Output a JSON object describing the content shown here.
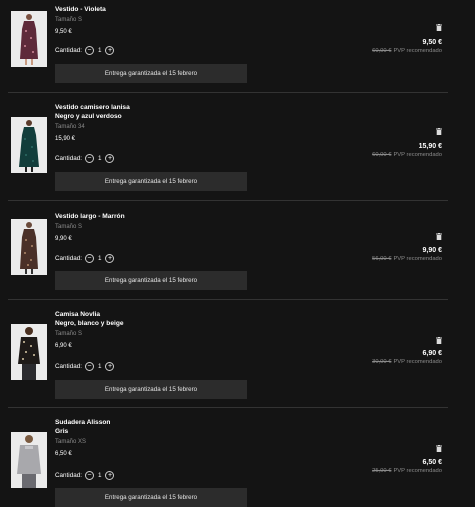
{
  "cart": {
    "quantity_label": "Cantidad:",
    "items": [
      {
        "name_line1": "Vestido - Violeta",
        "name_line2": "",
        "size": "Tamaño S",
        "unit_price": "9,50 €",
        "quantity": "1",
        "delivery": "Entrega garantizada el 15 febrero",
        "price": "9,50 €",
        "old_price": "60,00 €",
        "rrp_label": "PVP recomendado",
        "colors": {
          "garment": "#5e2a3a",
          "pattern": "#d08a9a"
        }
      },
      {
        "name_line1": "Vestido camisero Ianisa",
        "name_line2": "Negro y azul verdoso",
        "size": "Tamaño 34",
        "unit_price": "15,90 €",
        "quantity": "1",
        "delivery": "Entrega garantizada el 15 febrero",
        "price": "15,90 €",
        "old_price": "60,00 €",
        "rrp_label": "PVP recomendado",
        "colors": {
          "garment": "#123d3b",
          "pattern": "#2c6b63"
        }
      },
      {
        "name_line1": "Vestido largo - Marrón",
        "name_line2": "",
        "size": "Tamaño S",
        "unit_price": "9,90 €",
        "quantity": "1",
        "delivery": "Entrega garantizada el 15 febrero",
        "price": "9,90 €",
        "old_price": "56,00 €",
        "rrp_label": "PVP recomendado",
        "colors": {
          "garment": "#4a3028",
          "pattern": "#b08a6a"
        }
      },
      {
        "name_line1": "Camisa Novlia",
        "name_line2": "Negro, blanco y beige",
        "size": "Tamaño S",
        "unit_price": "6,90 €",
        "quantity": "1",
        "delivery": "Entrega garantizada el 15 febrero",
        "price": "6,90 €",
        "old_price": "30,00 €",
        "rrp_label": "PVP recomendado",
        "colors": {
          "garment": "#1e1a18",
          "pattern": "#d9c9a8"
        }
      },
      {
        "name_line1": "Sudadera Alisson",
        "name_line2": "Gris",
        "size": "Tamaño XS",
        "unit_price": "6,50 €",
        "quantity": "1",
        "delivery": "Entrega garantizada el 15 febrero",
        "price": "6,50 €",
        "old_price": "25,00 €",
        "rrp_label": "PVP recomendado",
        "colors": {
          "garment": "#a8a8ac",
          "pattern": "#c8c8cc"
        }
      }
    ]
  },
  "icons": {
    "remove": "trash-icon",
    "decrease": "minus-icon",
    "increase": "plus-icon"
  }
}
